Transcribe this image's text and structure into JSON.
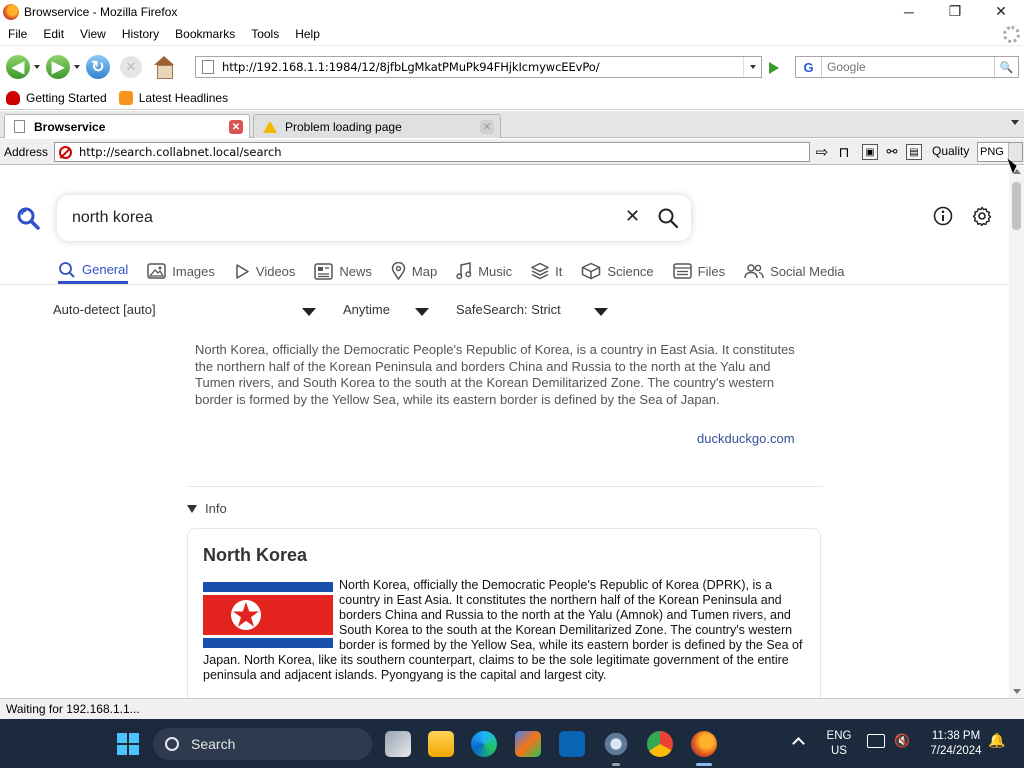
{
  "window": {
    "title": "Browservice - Mozilla Firefox",
    "controls": {
      "minimize": "─",
      "maximize": "❐",
      "close": "✕"
    }
  },
  "menu": [
    "File",
    "Edit",
    "View",
    "History",
    "Bookmarks",
    "Tools",
    "Help"
  ],
  "nav": {
    "url": "http://192.168.1.1:1984/12/8jfbLgMkatPMuPk94FHjkIcmywcEEvPo/",
    "search_placeholder": "Google",
    "search_engine_glyph": "G"
  },
  "bookmarks": [
    {
      "label": "Getting Started",
      "icon": "getting-started-icon"
    },
    {
      "label": "Latest Headlines",
      "icon": "rss-icon"
    }
  ],
  "tabs": [
    {
      "label": "Browservice",
      "active": true
    },
    {
      "label": "Problem loading page",
      "active": false
    }
  ],
  "inner_toolbar": {
    "address_label": "Address",
    "address_url": "http://search.collabnet.local/search",
    "quality_label": "Quality",
    "format_value": "PNG"
  },
  "search": {
    "query": "north korea",
    "categories": [
      {
        "label": "General",
        "icon": "search-icon",
        "active": true
      },
      {
        "label": "Images",
        "icon": "image-icon"
      },
      {
        "label": "Videos",
        "icon": "play-icon"
      },
      {
        "label": "News",
        "icon": "newspaper-icon"
      },
      {
        "label": "Map",
        "icon": "map-pin-icon"
      },
      {
        "label": "Music",
        "icon": "music-icon"
      },
      {
        "label": "It",
        "icon": "layers-icon"
      },
      {
        "label": "Science",
        "icon": "cube-icon"
      },
      {
        "label": "Files",
        "icon": "files-icon"
      },
      {
        "label": "Social Media",
        "icon": "people-icon"
      }
    ],
    "filters": {
      "language": "Auto-detect [auto]",
      "time": "Anytime",
      "safesearch": "SafeSearch: Strict"
    }
  },
  "answer": {
    "text": "North Korea, officially the Democratic People's Republic of Korea, is a country in East Asia. It constitutes the northern half of the Korean Peninsula and borders China and Russia to the north at the Yalu and Tumen rivers, and South Korea to the south at the Korean Demilitarized Zone. The country's western border is formed by the Yellow Sea, while its eastern border is defined by the Sea of Japan.",
    "source": "duckduckgo.com"
  },
  "infobox": {
    "toggle_label": "Info",
    "title": "North Korea",
    "text": "North Korea, officially the Democratic People's Republic of Korea (DPRK), is a country in East Asia. It constitutes the northern half of the Korean Peninsula and borders China and Russia to the north at the Yalu (Amnok) and Tumen rivers, and South Korea to the south at the Korean Demilitarized Zone. The country's western border is formed by the Yellow Sea, while its eastern border is defined by the Sea of Japan. North Korea, like its southern counterpart, claims to be the sole legitimate government of the entire peninsula and adjacent islands. Pyongyang is the capital and largest city."
  },
  "status": "Waiting for 192.168.1.1...",
  "taskbar": {
    "search_label": "Search",
    "lang_line1": "ENG",
    "lang_line2": "US",
    "time": "11:38 PM",
    "date": "7/24/2024"
  },
  "colors": {
    "accent": "#3050c8",
    "link": "#344f9e",
    "taskbar_bg": "#1c2a3e"
  }
}
